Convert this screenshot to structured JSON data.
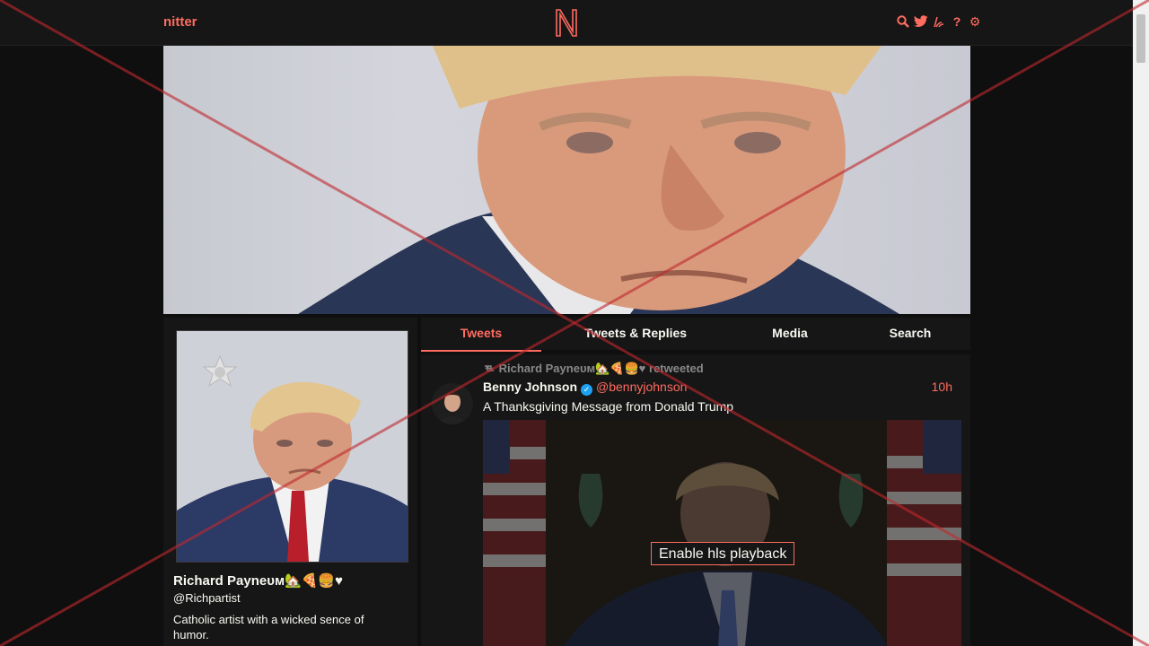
{
  "navbar": {
    "brand": "nitter",
    "icons": [
      "search-icon",
      "twitter-bird-icon",
      "rss-icon",
      "help-icon",
      "settings-gear-icon"
    ],
    "icon_glyphs": [
      "",
      "",
      "",
      "?",
      "⚙"
    ]
  },
  "profile": {
    "fullname": "Richard Payneᴜᴍ🏡🍕🍔♥",
    "username": "@Richpartist",
    "bio": "Catholic artist with a wicked sence of humor."
  },
  "tabs": [
    {
      "label": "Tweets",
      "active": true
    },
    {
      "label": "Tweets & Replies",
      "active": false
    },
    {
      "label": "Media",
      "active": false
    },
    {
      "label": "Search",
      "active": false
    }
  ],
  "tweet": {
    "retweet_header": "Richard Payneᴜᴍ🏡🍕🍔♥ retweeted",
    "fullname": "Benny Johnson",
    "username": "@bennyjohnson",
    "date": "10h",
    "content": "A Thanksgiving Message from Donald Trump",
    "video_button": "Enable hls playback"
  },
  "colors": {
    "accent": "#ff6c60",
    "background": "#0f0f0f",
    "panel": "#161616",
    "text": "#f8f8f2",
    "muted": "#888889",
    "overlay_x": "#c0282e"
  }
}
